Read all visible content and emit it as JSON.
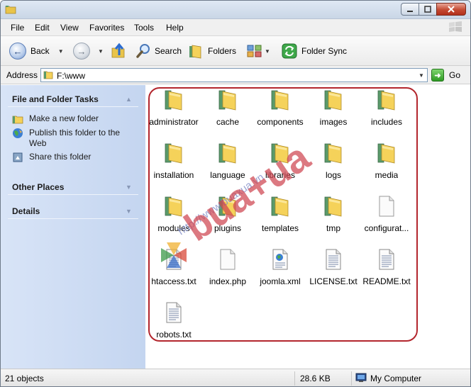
{
  "menu": [
    "File",
    "Edit",
    "View",
    "Favorites",
    "Tools",
    "Help"
  ],
  "toolbar": {
    "back_label": "Back",
    "search_label": "Search",
    "folders_label": "Folders",
    "folder_sync_label": "Folder Sync"
  },
  "address": {
    "label": "Address",
    "value": "F:\\www",
    "go_label": "Go"
  },
  "left_pane": {
    "file_folder_tasks": {
      "heading": "File and Folder Tasks",
      "items": [
        "Make a new folder",
        "Publish this folder to the Web",
        "Share this folder"
      ]
    },
    "other_places": {
      "heading": "Other Places"
    },
    "details": {
      "heading": "Details"
    }
  },
  "items": [
    {
      "name": "administrator",
      "type": "folder"
    },
    {
      "name": "cache",
      "type": "folder"
    },
    {
      "name": "components",
      "type": "folder"
    },
    {
      "name": "images",
      "type": "folder"
    },
    {
      "name": "includes",
      "type": "folder"
    },
    {
      "name": "installation",
      "type": "folder"
    },
    {
      "name": "language",
      "type": "folder"
    },
    {
      "name": "libraries",
      "type": "folder"
    },
    {
      "name": "logs",
      "type": "folder"
    },
    {
      "name": "media",
      "type": "folder"
    },
    {
      "name": "modules",
      "type": "folder"
    },
    {
      "name": "plugins",
      "type": "folder"
    },
    {
      "name": "templates",
      "type": "folder"
    },
    {
      "name": "tmp",
      "type": "folder"
    },
    {
      "name": "configurat...",
      "type": "blank"
    },
    {
      "name": "htaccess.txt",
      "type": "text"
    },
    {
      "name": "index.php",
      "type": "php"
    },
    {
      "name": "joomla.xml",
      "type": "xml"
    },
    {
      "name": "LICENSE.txt",
      "type": "text"
    },
    {
      "name": "README.txt",
      "type": "text"
    },
    {
      "name": "robots.txt",
      "type": "text"
    }
  ],
  "watermark": {
    "url_text": "http://www.buaxua.vn",
    "brand_text": "bua+ua"
  },
  "status": {
    "objects": "21 objects",
    "size": "28.6 KB",
    "location": "My Computer"
  },
  "colors": {
    "accent_ring": "#b3262d",
    "pane_bg": "#c4d5f0",
    "folder_yellow": "#f5d25a",
    "folder_green": "#5a9a6a"
  }
}
